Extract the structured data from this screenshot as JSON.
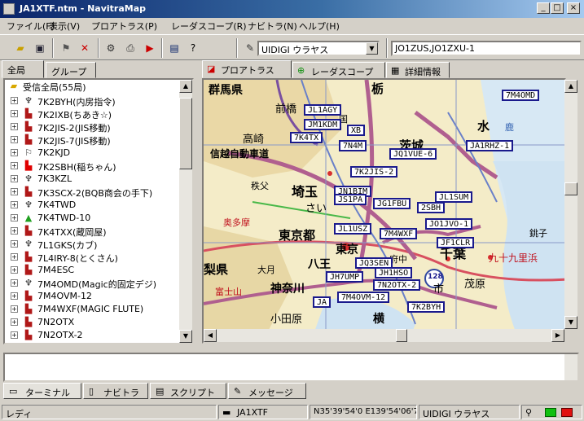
{
  "window": {
    "title": "JA1XTF.ntm - NavitraMap",
    "min": "_",
    "max": "□",
    "close": "×"
  },
  "menu": [
    "ファイル(F)",
    "表示(V)",
    "プロアトラス(P)",
    "レーダスコープ(R)",
    "ナビトラ(N)",
    "ヘルプ(H)"
  ],
  "toolbar": {
    "icons": [
      "open-folder-icon",
      "save-icon",
      "stations-icon",
      "delete-icon",
      "filter-icon",
      "print-icon",
      "play-log-icon",
      "book-icon",
      "help-icon"
    ],
    "station_select": "UIDIGI ウラヤス",
    "path_value": "JO1ZUS,JO1ZXU-1"
  },
  "left_tabs": [
    "全局",
    "グループ"
  ],
  "tree": {
    "root": "受信全局(55局)",
    "items": [
      {
        "icon": "antenna",
        "label": "7K2BYH(内房指令)"
      },
      {
        "icon": "car",
        "label": "7K2IXB(ちあき☆)"
      },
      {
        "icon": "car",
        "label": "7K2JIS-2(JIS移動)"
      },
      {
        "icon": "car",
        "label": "7K2JIS-7(JIS移動)"
      },
      {
        "icon": "other",
        "label": "7K2KJD"
      },
      {
        "icon": "car-red",
        "label": "7K2SBH(稲ちゃん)"
      },
      {
        "icon": "antenna",
        "label": "7K3KZL"
      },
      {
        "icon": "car",
        "label": "7K3SCX-2(BQB商会の手下)"
      },
      {
        "icon": "antenna",
        "label": "7K4TWD"
      },
      {
        "icon": "tent",
        "label": "7K4TWD-10"
      },
      {
        "icon": "car",
        "label": "7K4TXX(蔵岡屋)"
      },
      {
        "icon": "antenna",
        "label": "7L1GKS(カブ)"
      },
      {
        "icon": "car",
        "label": "7L4IRY-8(とくさん)"
      },
      {
        "icon": "car",
        "label": "7M4ESC"
      },
      {
        "icon": "antenna",
        "label": "7M4OMD(Magic的固定デジ)"
      },
      {
        "icon": "car",
        "label": "7M4OVM-12"
      },
      {
        "icon": "car",
        "label": "7M4WXF(MAGIC FLUTE)"
      },
      {
        "icon": "car",
        "label": "7N2OTX"
      },
      {
        "icon": "car",
        "label": "7N2OTX-2"
      }
    ]
  },
  "right_tabs": [
    "プロアトラス",
    "レーダスコープ",
    "詳細情報"
  ],
  "map": {
    "labels": [
      "群馬県",
      "前橋",
      "高崎",
      "信越自動車道",
      "秩父",
      "埼玉",
      "さい",
      "奥多摩",
      "東京都",
      "東京",
      "八王",
      "神奈川",
      "梨県",
      "大月",
      "富士山",
      "小田原",
      "茨城",
      "水",
      "鹿",
      "千葉",
      "市",
      "茂原",
      "九十九里浜",
      "銚子",
      "横",
      "国",
      "栃",
      "府中"
    ],
    "callsigns": [
      "7M4OMD",
      "JL1AGY",
      "JM1KDM",
      "XB",
      "7K4TX",
      "7N4M",
      "JQ1VUE-6",
      "JA1RHZ-1",
      "7K2JIS-2",
      "JN1BIM",
      "JS1PA",
      "JG1FBU",
      "JL1SUM",
      "2SBH",
      "JL1USZ",
      "7M4WXF",
      "JO1JVO-1",
      "JF1CLR",
      "JQ3SEN",
      "JH1HSO",
      "JH7UMP",
      "7N2OTX-2",
      "7M4OVM-12",
      "7K2BYH",
      "JA"
    ],
    "route_badge": "128"
  },
  "bottom_tabs": [
    "ターミナル",
    "ナビトラ",
    "スクリプト",
    "メッセージ"
  ],
  "status": {
    "state": "レディ",
    "callsign": "JA1XTF",
    "coords": "N35'39'54'0 E139'54'06'7",
    "station": "UIDIGI ウラヤス"
  }
}
